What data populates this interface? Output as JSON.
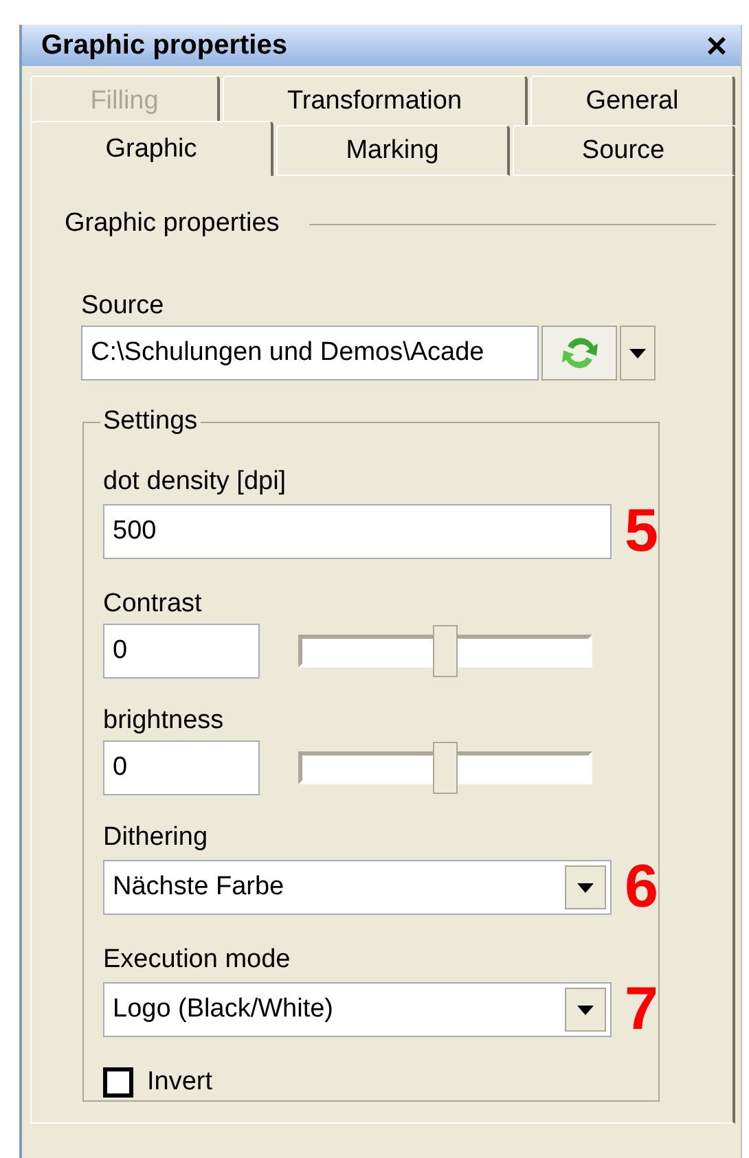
{
  "window": {
    "title": "Graphic properties",
    "close": "×"
  },
  "tab_rows": [
    {
      "tabs": [
        {
          "label": "Filling",
          "selected": false,
          "disabled": true
        },
        {
          "label": "Transformation",
          "selected": false,
          "disabled": false
        },
        {
          "label": "General",
          "selected": false,
          "disabled": false
        }
      ]
    },
    {
      "tabs": [
        {
          "label": "Graphic",
          "selected": true,
          "disabled": false
        },
        {
          "label": "Marking",
          "selected": false,
          "disabled": false
        },
        {
          "label": "Source",
          "selected": false,
          "disabled": false
        }
      ]
    }
  ],
  "section_title": "Graphic properties",
  "source": {
    "label": "Source",
    "value": "C:\\Schulungen und Demos\\Acade"
  },
  "settings": {
    "legend": "Settings",
    "fields": [
      {
        "kind": "text",
        "label": "dot density [dpi]",
        "value": "500",
        "callout": "5"
      },
      {
        "kind": "slider",
        "label": "Contrast",
        "value": "0",
        "level": 0.5
      },
      {
        "kind": "slider",
        "label": "brightness",
        "value": "0",
        "level": 0.5
      },
      {
        "kind": "combo",
        "label": "Dithering",
        "value": "Nächste Farbe",
        "callout": "6"
      },
      {
        "kind": "combo",
        "label": "Execution mode",
        "value": "Logo (Black/White)",
        "callout": "7"
      },
      {
        "kind": "checkbox",
        "label": "Invert",
        "checked": false
      }
    ]
  }
}
